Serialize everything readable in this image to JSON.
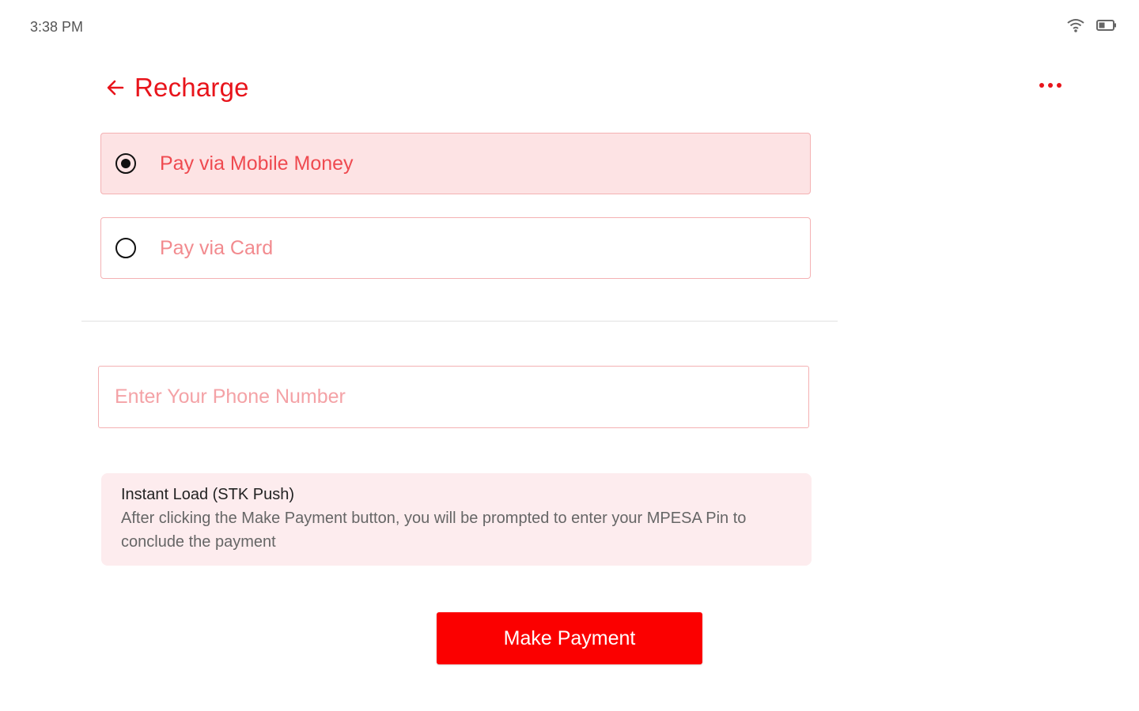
{
  "status_bar": {
    "time": "3:38 PM",
    "icons": [
      "wifi-icon",
      "battery-icon"
    ]
  },
  "header": {
    "back_icon": "arrow-left-icon",
    "title": "Recharge",
    "more_icon": "more-horizontal-icon"
  },
  "payment_options": [
    {
      "label": "Pay via Mobile Money",
      "selected": true
    },
    {
      "label": "Pay via Card",
      "selected": false
    }
  ],
  "phone_field": {
    "placeholder": "Enter Your Phone Number",
    "value": ""
  },
  "info": {
    "title": "Instant Load (STK Push)",
    "body": "After clicking the  Make Payment button, you will be prompted to enter your MPESA Pin to conclude the payment"
  },
  "actions": {
    "make_payment_label": "Make Payment"
  },
  "colors": {
    "accent": "#e8141b",
    "button": "#fb0000",
    "selected_bg": "#fde3e4",
    "border": "#f4b1b3",
    "info_bg": "#fdecee"
  }
}
